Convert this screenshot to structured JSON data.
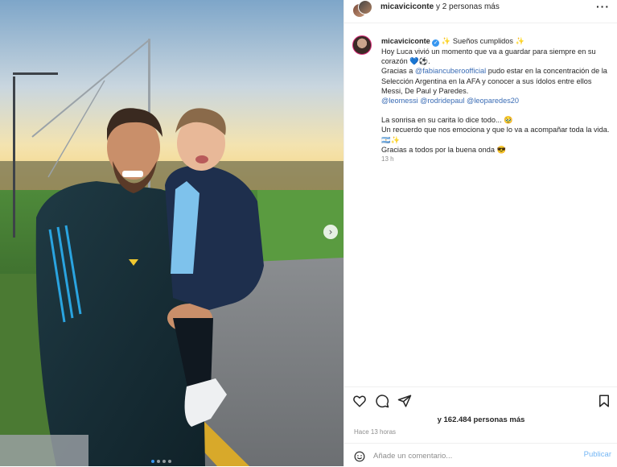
{
  "header": {
    "username": "micaviciconte",
    "collab_text": "y 2 personas más",
    "more_icon": "more-horizontal-icon"
  },
  "caption": {
    "username": "micaviciconte",
    "title": "Sueños cumplidos",
    "line1": "Hoy Luca vivió un momento que va a guardar para siempre en su corazón 💙⚽.",
    "line2_pre": "Gracias a ",
    "line2_mention": "@fabiancuberoofficial",
    "line2_post": " pudo estar en la concentración de la Selección Argentina en la AFA y conocer a sus ídolos entre ellos Messi, De Paul y Paredes.",
    "mentions": [
      "@leomessi",
      "@rodridepaul",
      "@leoparedes20"
    ],
    "line3": "La sonrisa en su carita lo dice todo... 🥹",
    "line4": "Un recuerdo que nos emociona y que lo va a acompañar toda la vida. 🇦🇷✨",
    "line5": "Gracias a todos por la buena onda 😎",
    "time": "13 h"
  },
  "actions": {
    "like_icon": "heart-icon",
    "comment_icon": "comment-icon",
    "share_icon": "send-icon",
    "save_icon": "bookmark-icon"
  },
  "likes_text": "y 162.484 personas más",
  "posted_ago": "Hace 13 horas",
  "comment": {
    "placeholder": "Añade un comentario...",
    "value": "",
    "publish_label": "Publicar",
    "emoji_icon": "smiley-icon"
  },
  "carousel": {
    "next_icon": "chevron-right-icon",
    "slide_count": 4,
    "active_slide": 1
  }
}
